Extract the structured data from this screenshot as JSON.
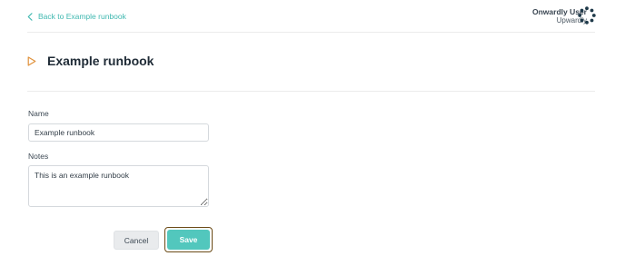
{
  "header": {
    "back_link_label": "Back to Example runbook",
    "user_name": "Onwardly User",
    "user_org": "Upwardly"
  },
  "page": {
    "title": "Example runbook"
  },
  "form": {
    "name_label": "Name",
    "name_value": "Example runbook",
    "notes_label": "Notes",
    "notes_value": "This is an example runbook"
  },
  "actions": {
    "cancel_label": "Cancel",
    "save_label": "Save"
  },
  "colors": {
    "accent": "#3fb8b0",
    "save_button": "#52c7bd",
    "play_icon": "#e0913a",
    "avatar": "#1f3a4a"
  },
  "icons": {
    "back": "chevron-left-icon",
    "title": "play-icon",
    "avatar": "dots-ring-icon"
  }
}
